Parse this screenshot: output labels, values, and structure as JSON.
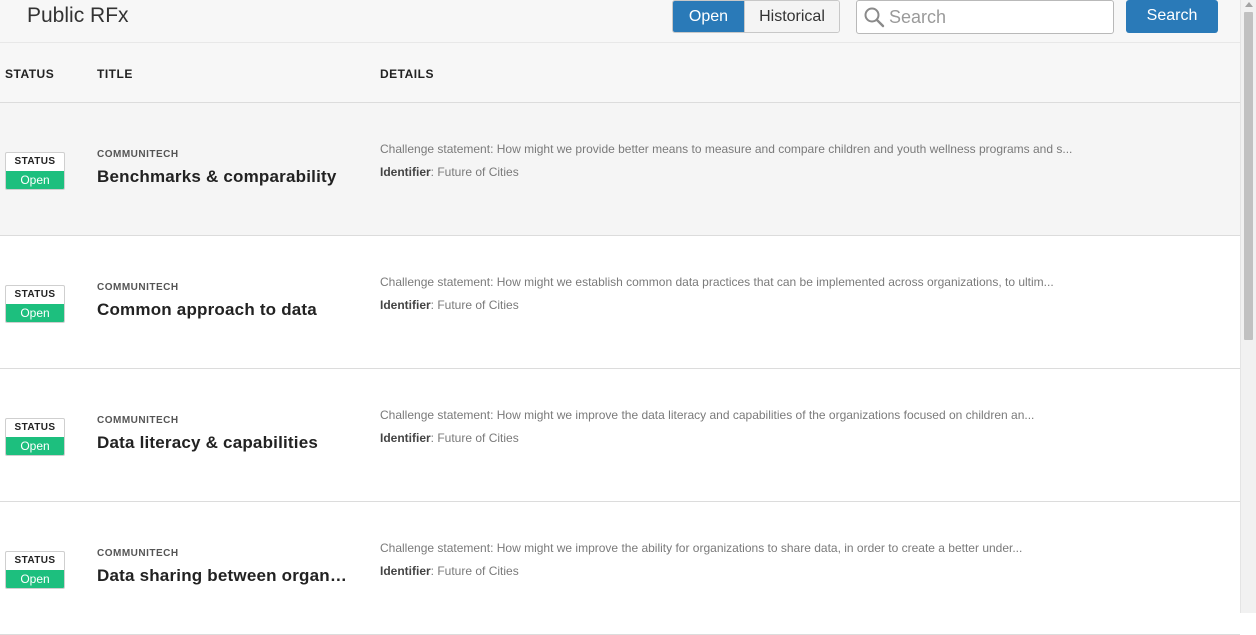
{
  "page": {
    "title": "Public RFx"
  },
  "filters": {
    "open_label": "Open",
    "historical_label": "Historical",
    "active": "Open"
  },
  "search": {
    "placeholder": "Search",
    "value": "",
    "button_label": "Search"
  },
  "table": {
    "columns": {
      "status": "STATUS",
      "title": "TITLE",
      "details": "DETAILS"
    },
    "rows": [
      {
        "status_label": "STATUS",
        "status_value": "Open",
        "organization": "COMMUNITECH",
        "title": "Benchmarks & comparability",
        "description": "Challenge statement: How might we provide better means to measure and compare children and youth wellness programs and s...",
        "identifier_label": "Identifier",
        "identifier_value": ": Future of Cities"
      },
      {
        "status_label": "STATUS",
        "status_value": "Open",
        "organization": "COMMUNITECH",
        "title": "Common approach to data",
        "description": "Challenge statement: How might we establish common data practices that can be implemented across organizations, to ultim...",
        "identifier_label": "Identifier",
        "identifier_value": ": Future of Cities"
      },
      {
        "status_label": "STATUS",
        "status_value": "Open",
        "organization": "COMMUNITECH",
        "title": "Data literacy & capabilities",
        "description": "Challenge statement: How might we improve the data literacy and capabilities of the organizations focused on children an...",
        "identifier_label": "Identifier",
        "identifier_value": ": Future of Cities"
      },
      {
        "status_label": "STATUS",
        "status_value": "Open",
        "organization": "COMMUNITECH",
        "title": "Data sharing between organizations",
        "description": "Challenge statement: How might we improve the ability for organizations to share data, in order to create a better under...",
        "identifier_label": "Identifier",
        "identifier_value": ": Future of Cities"
      }
    ]
  },
  "colors": {
    "accent": "#2a7ab8",
    "status_open": "#1dbf7e",
    "row_highlight": "#f5f5f5"
  },
  "icons": {
    "search": "search-icon"
  }
}
